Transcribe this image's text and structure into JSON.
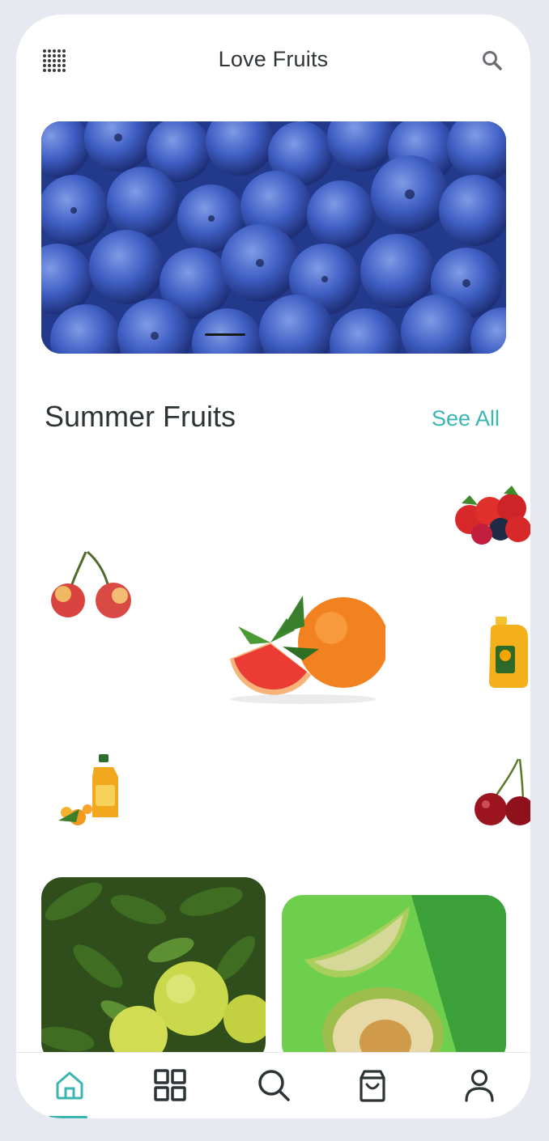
{
  "header": {
    "title": "Love Fruits",
    "menu_icon": "dotted-grid-icon",
    "search_icon": "search-icon"
  },
  "hero": {
    "image": "blueberries-photo",
    "active_slide": 1
  },
  "section": {
    "title": "Summer Fruits",
    "see_all_label": "See All"
  },
  "fruits": [
    {
      "name": "cherries"
    },
    {
      "name": "grapefruit-and-orange"
    },
    {
      "name": "strawberries-and-berries"
    },
    {
      "name": "orange-juice-bottle"
    },
    {
      "name": "orange-juice-with-citrus"
    },
    {
      "name": "red-cherries"
    }
  ],
  "cards": [
    {
      "image": "grapefruit-tree-photo"
    },
    {
      "image": "melon-slices-photo"
    }
  ],
  "bottom_nav": {
    "items": [
      {
        "icon": "home-icon",
        "active": true
      },
      {
        "icon": "grid-icon",
        "active": false
      },
      {
        "icon": "search-icon",
        "active": false
      },
      {
        "icon": "shopping-bag-icon",
        "active": false
      },
      {
        "icon": "user-icon",
        "active": false
      }
    ]
  },
  "colors": {
    "accent": "#3bb5b0",
    "text_dark": "#2d3436",
    "background": "#e6e9f0"
  }
}
